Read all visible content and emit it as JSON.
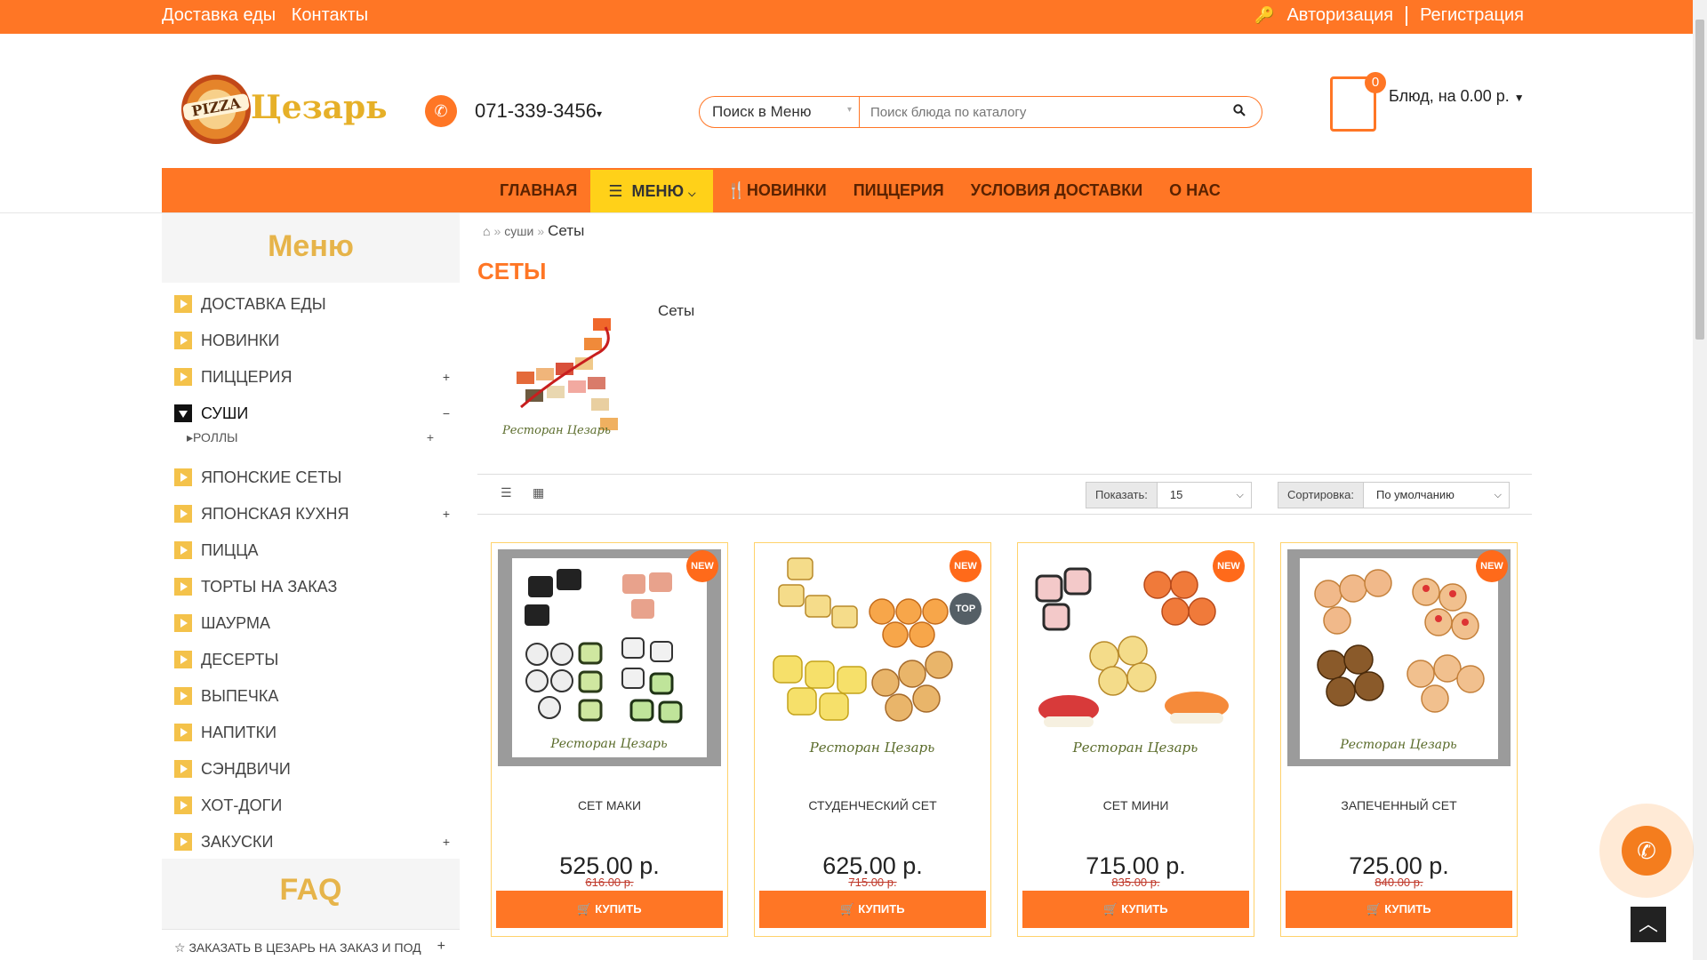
{
  "topbar": {
    "links": [
      "Доставка еды",
      "Контакты"
    ],
    "auth": "Авторизация",
    "register": "Регистрация"
  },
  "logo": {
    "badge": "PIZZA",
    "name": "Цезарь"
  },
  "phone": {
    "number": "071-339-3456"
  },
  "search": {
    "category": "Поиск в Меню",
    "placeholder": "Поиск блюда по каталогу"
  },
  "cart": {
    "count": "0",
    "summary": "Блюд, на 0.00 р."
  },
  "nav": {
    "items": [
      "ГЛАВНАЯ",
      "МЕНЮ",
      "НОВИНКИ",
      "ПИЦЦЕРИЯ",
      "УСЛОВИЯ ДОСТАВКИ",
      "О НАС"
    ]
  },
  "sidebar": {
    "title": "Меню",
    "items": [
      {
        "label": "ДОСТАВКА ЕДЫ",
        "pm": ""
      },
      {
        "label": "НОВИНКИ",
        "pm": ""
      },
      {
        "label": "ПИЦЦЕРИЯ",
        "pm": "+"
      },
      {
        "label": "СУШИ",
        "pm": "−"
      },
      {
        "label": "ЯПОНСКИЕ СЕТЫ",
        "pm": ""
      },
      {
        "label": "ЯПОНСКАЯ КУХНЯ",
        "pm": "+"
      },
      {
        "label": "ПИЦЦА",
        "pm": ""
      },
      {
        "label": "ТОРТЫ НА ЗАКАЗ",
        "pm": ""
      },
      {
        "label": "ШАУРМА",
        "pm": ""
      },
      {
        "label": "ДЕСЕРТЫ",
        "pm": ""
      },
      {
        "label": "ВЫПЕЧКА",
        "pm": ""
      },
      {
        "label": "НАПИТКИ",
        "pm": ""
      },
      {
        "label": "СЭНДВИЧИ",
        "pm": ""
      },
      {
        "label": "ХОТ-ДОГИ",
        "pm": ""
      },
      {
        "label": "ЗАКУСКИ",
        "pm": "+"
      }
    ],
    "subitem": {
      "label": "РОЛЛЫ",
      "pm": "+"
    },
    "faq_title": "FAQ",
    "faq_item": "ЗАКАЗАТЬ В ЦЕЗАРЬ НА ЗАКАЗ И ПОД"
  },
  "breadcrumb": {
    "parent": "суши",
    "current": "Сеты"
  },
  "category": {
    "title": "СЕТЫ",
    "description": "Сеты",
    "image_caption": "Ресторан Цезарь"
  },
  "toolbar": {
    "show_label": "Показать:",
    "show_value": "15",
    "sort_label": "Сортировка:",
    "sort_value": "По умолчанию"
  },
  "products": [
    {
      "name": "СЕТ МАКИ",
      "price": "525.00 р.",
      "old_price": "616.00 р.",
      "badges": [
        "NEW"
      ],
      "caption": "Ресторан Цезарь",
      "buy": "КУПИТЬ"
    },
    {
      "name": "СТУДЕНЧЕСКИЙ СЕТ",
      "price": "625.00 р.",
      "old_price": "715.00 р.",
      "badges": [
        "NEW",
        "TOP"
      ],
      "caption": "Ресторан Цезарь",
      "buy": "КУПИТЬ"
    },
    {
      "name": "СЕТ МИНИ",
      "price": "715.00 р.",
      "old_price": "835.00 р.",
      "badges": [
        "NEW"
      ],
      "caption": "Ресторан Цезарь",
      "buy": "КУПИТЬ"
    },
    {
      "name": "ЗАПЕЧЕННЫЙ СЕТ",
      "price": "725.00 р.",
      "old_price": "840.00 р.",
      "badges": [
        "NEW"
      ],
      "caption": "Ресторан Цезарь",
      "buy": "КУПИТЬ"
    }
  ],
  "colors": {
    "brand_orange": "#ff7625",
    "menu_yellow": "#ffd119",
    "gold": "#e6b44a"
  }
}
